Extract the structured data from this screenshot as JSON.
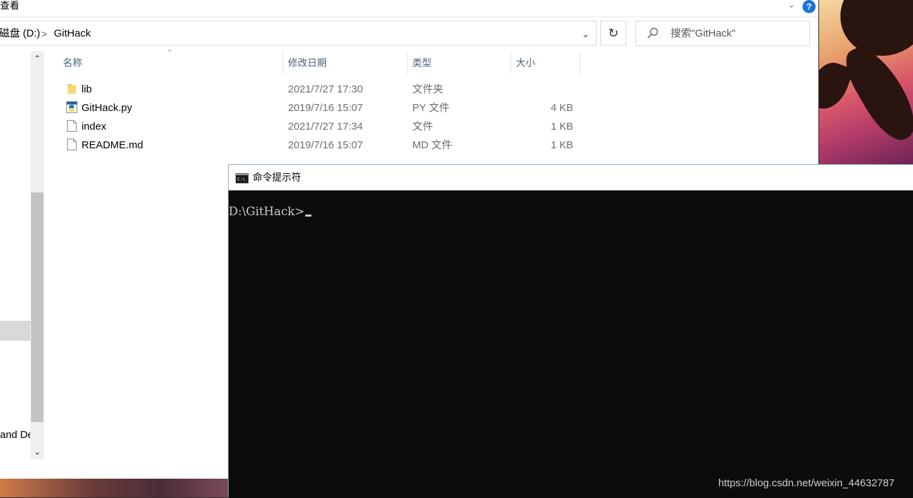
{
  "ribbon": {
    "tab_label": "查看",
    "help_glyph": "?"
  },
  "address_bar": {
    "crumbs": [
      {
        "label": "磁盘 (D:)"
      },
      {
        "label": "GitHack"
      }
    ],
    "separator": ">",
    "search_placeholder": "搜索\"GitHack\""
  },
  "nav_pane": {
    "partial_item_text": "and De"
  },
  "file_list": {
    "columns": {
      "name": "名称",
      "date": "修改日期",
      "type": "类型",
      "size": "大小"
    },
    "rows": [
      {
        "name": "lib",
        "date": "2021/7/27 17:30",
        "type": "文件夹",
        "size": "",
        "icon": "folder-icon"
      },
      {
        "name": "GitHack.py",
        "date": "2019/7/16 15:07",
        "type": "PY 文件",
        "size": "4 KB",
        "icon": "python-file-icon"
      },
      {
        "name": "index",
        "date": "2021/7/27 17:34",
        "type": "文件",
        "size": "1 KB",
        "icon": "file-icon"
      },
      {
        "name": "README.md",
        "date": "2019/7/16 15:07",
        "type": "MD 文件",
        "size": "1 KB",
        "icon": "file-icon"
      }
    ]
  },
  "cmd": {
    "title": "命令提示符",
    "prompt": "D:\\GitHack>"
  },
  "watermark": "https://blog.csdn.net/weixin_44632787",
  "colors": {
    "help_blue": "#1a73d6",
    "cmd_background": "#0c0c0c",
    "header_text": "#4c607a"
  }
}
